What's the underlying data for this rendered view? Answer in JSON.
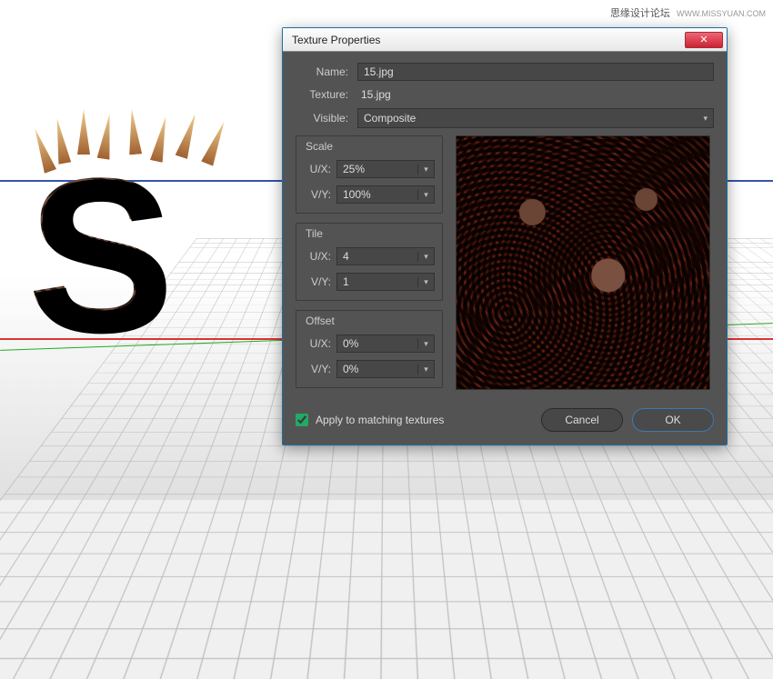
{
  "watermark": {
    "main": "思缘设计论坛",
    "sub": "WWW.MISSYUAN.COM"
  },
  "dialog": {
    "title": "Texture Properties",
    "name_label": "Name:",
    "name_value": "15.jpg",
    "texture_label": "Texture:",
    "texture_value": "15.jpg",
    "visible_label": "Visible:",
    "visible_value": "Composite",
    "scale": {
      "legend": "Scale",
      "ux_label": "U/X:",
      "ux_value": "25%",
      "vy_label": "V/Y:",
      "vy_value": "100%"
    },
    "tile": {
      "legend": "Tile",
      "ux_label": "U/X:",
      "ux_value": "4",
      "vy_label": "V/Y:",
      "vy_value": "1"
    },
    "offset": {
      "legend": "Offset",
      "ux_label": "U/X:",
      "ux_value": "0%",
      "vy_label": "V/Y:",
      "vy_value": "0%"
    },
    "apply_label": "Apply to matching textures",
    "cancel_label": "Cancel",
    "ok_label": "OK"
  }
}
